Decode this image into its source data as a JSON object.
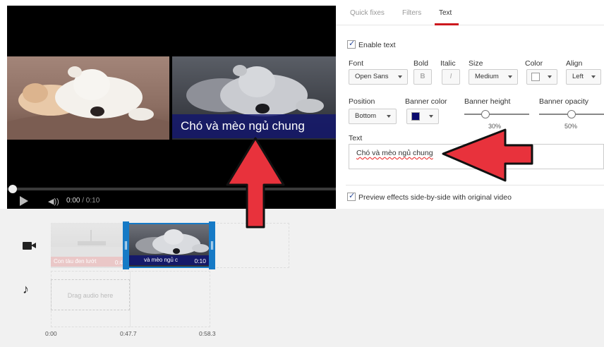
{
  "player": {
    "banner_text": "Chó và mèo ngủ chung",
    "time_current": "0:00",
    "time_total": "/ 0:10",
    "progress": 0
  },
  "tabs": [
    {
      "label": "Quick fixes"
    },
    {
      "label": "Filters"
    },
    {
      "label": "Text",
      "active": true
    }
  ],
  "text_settings": {
    "enable_label": "Enable text",
    "enabled": true,
    "font_label": "Font",
    "font_value": "Open Sans",
    "bold_label": "Bold",
    "bold_glyph": "B",
    "italic_label": "Italic",
    "italic_glyph": "I",
    "size_label": "Size",
    "size_value": "Medium",
    "color_label": "Color",
    "color_value": "#ffffff",
    "align_label": "Align",
    "align_value": "Left",
    "position_label": "Position",
    "position_value": "Bottom",
    "banner_color_label": "Banner color",
    "banner_color_value": "#0a0a6e",
    "banner_height_label": "Banner height",
    "banner_height_value": "30%",
    "banner_height_level": 0.3,
    "banner_opacity_label": "Banner opacity",
    "banner_opacity_value": "50%",
    "banner_opacity_level": 0.5,
    "text_label": "Text",
    "text_value": "Chó và mèo ngủ chung",
    "preview_label": "Preview effects side-by-side with original video",
    "preview_enabled": true
  },
  "timeline": {
    "clip1_caption": "Con tàu đen lướt",
    "clip1_duration": "0:4",
    "clip2_caption": "và mèo ngủ c",
    "clip2_duration": "0:10",
    "audio_placeholder": "Drag audio here",
    "ticks": [
      "0:00",
      "0:47.7",
      "0:58.3"
    ]
  },
  "icons": {
    "video_track": "video-camera-icon",
    "audio_track": "music-note-icon",
    "play": "play-icon",
    "volume": "volume-icon"
  },
  "colors": {
    "accent_red": "#cc181e",
    "selection_blue": "#167ac6",
    "annotation_red": "#e8323c"
  }
}
